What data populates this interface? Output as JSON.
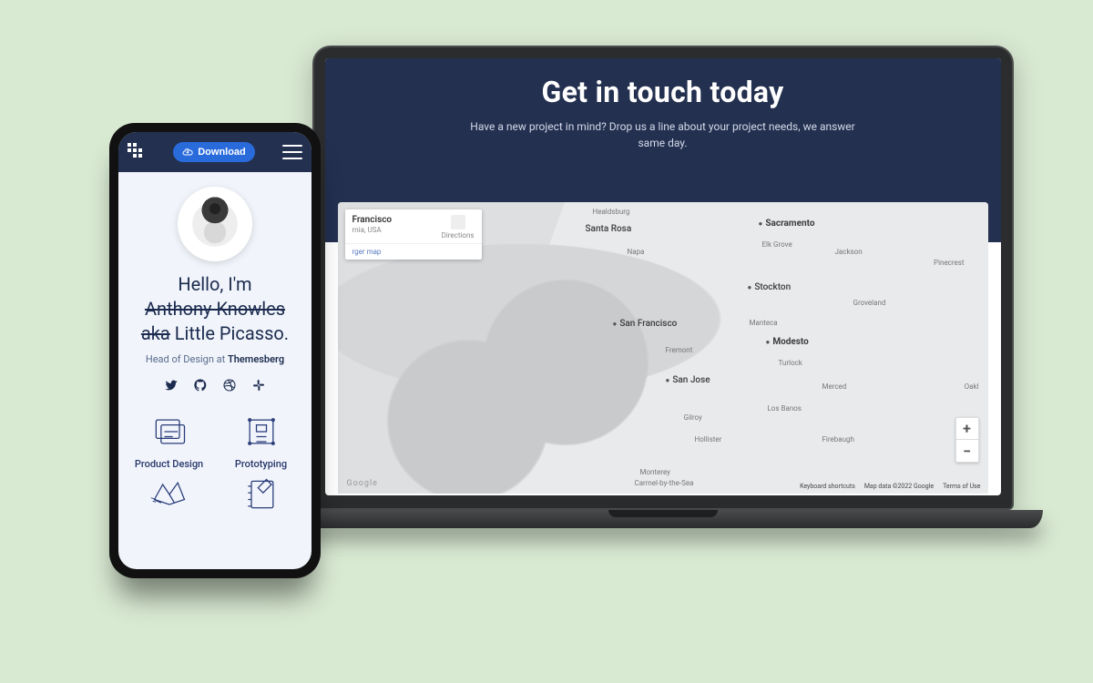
{
  "laptop": {
    "hero_title": "Get in touch today",
    "hero_sub": "Have a new project in mind? Drop us a line about your project needs, we answer same day.",
    "map_card": {
      "title": "Francisco",
      "subtitle": "rnia, USA",
      "directions": "Directions",
      "larger": "rger map"
    },
    "map_cities": {
      "santarosa": "Santa Rosa",
      "healdsburg": "Healdsburg",
      "napa": "Napa",
      "sacramento": "Sacramento",
      "elkgrove": "Elk Grove",
      "jackson": "Jackson",
      "pinecrest": "Pinecrest",
      "stockton": "Stockton",
      "groveland": "Groveland",
      "sanfrancisco": "San Francisco",
      "manteca": "Manteca",
      "modesto": "Modesto",
      "fremont": "Fremont",
      "turlock": "Turlock",
      "sanjose": "San Jose",
      "merced": "Merced",
      "oak": "Oakl",
      "losbanos": "Los Banos",
      "gilroy": "Gilroy",
      "hollister": "Hollister",
      "firebaugh": "Firebaugh",
      "monterey": "Monterey",
      "carmel": "Carmel-by-the-Sea"
    },
    "map_logo": "Google",
    "map_footer": {
      "kb": "Keyboard shortcuts",
      "attr": "Map data ©2022 Google",
      "terms": "Terms of Use"
    },
    "zoom_in": "+",
    "zoom_out": "−"
  },
  "phone": {
    "download": "Download",
    "hello_line1": "Hello, I'm",
    "hello_line2": "Anthony Knowles",
    "hello_line3a": "aka",
    "hello_line3b": " Little Picasso.",
    "role_prefix": "Head of Design at ",
    "company": "Themesberg",
    "skills": {
      "s1": "Product Design",
      "s2": "Prototyping"
    }
  }
}
